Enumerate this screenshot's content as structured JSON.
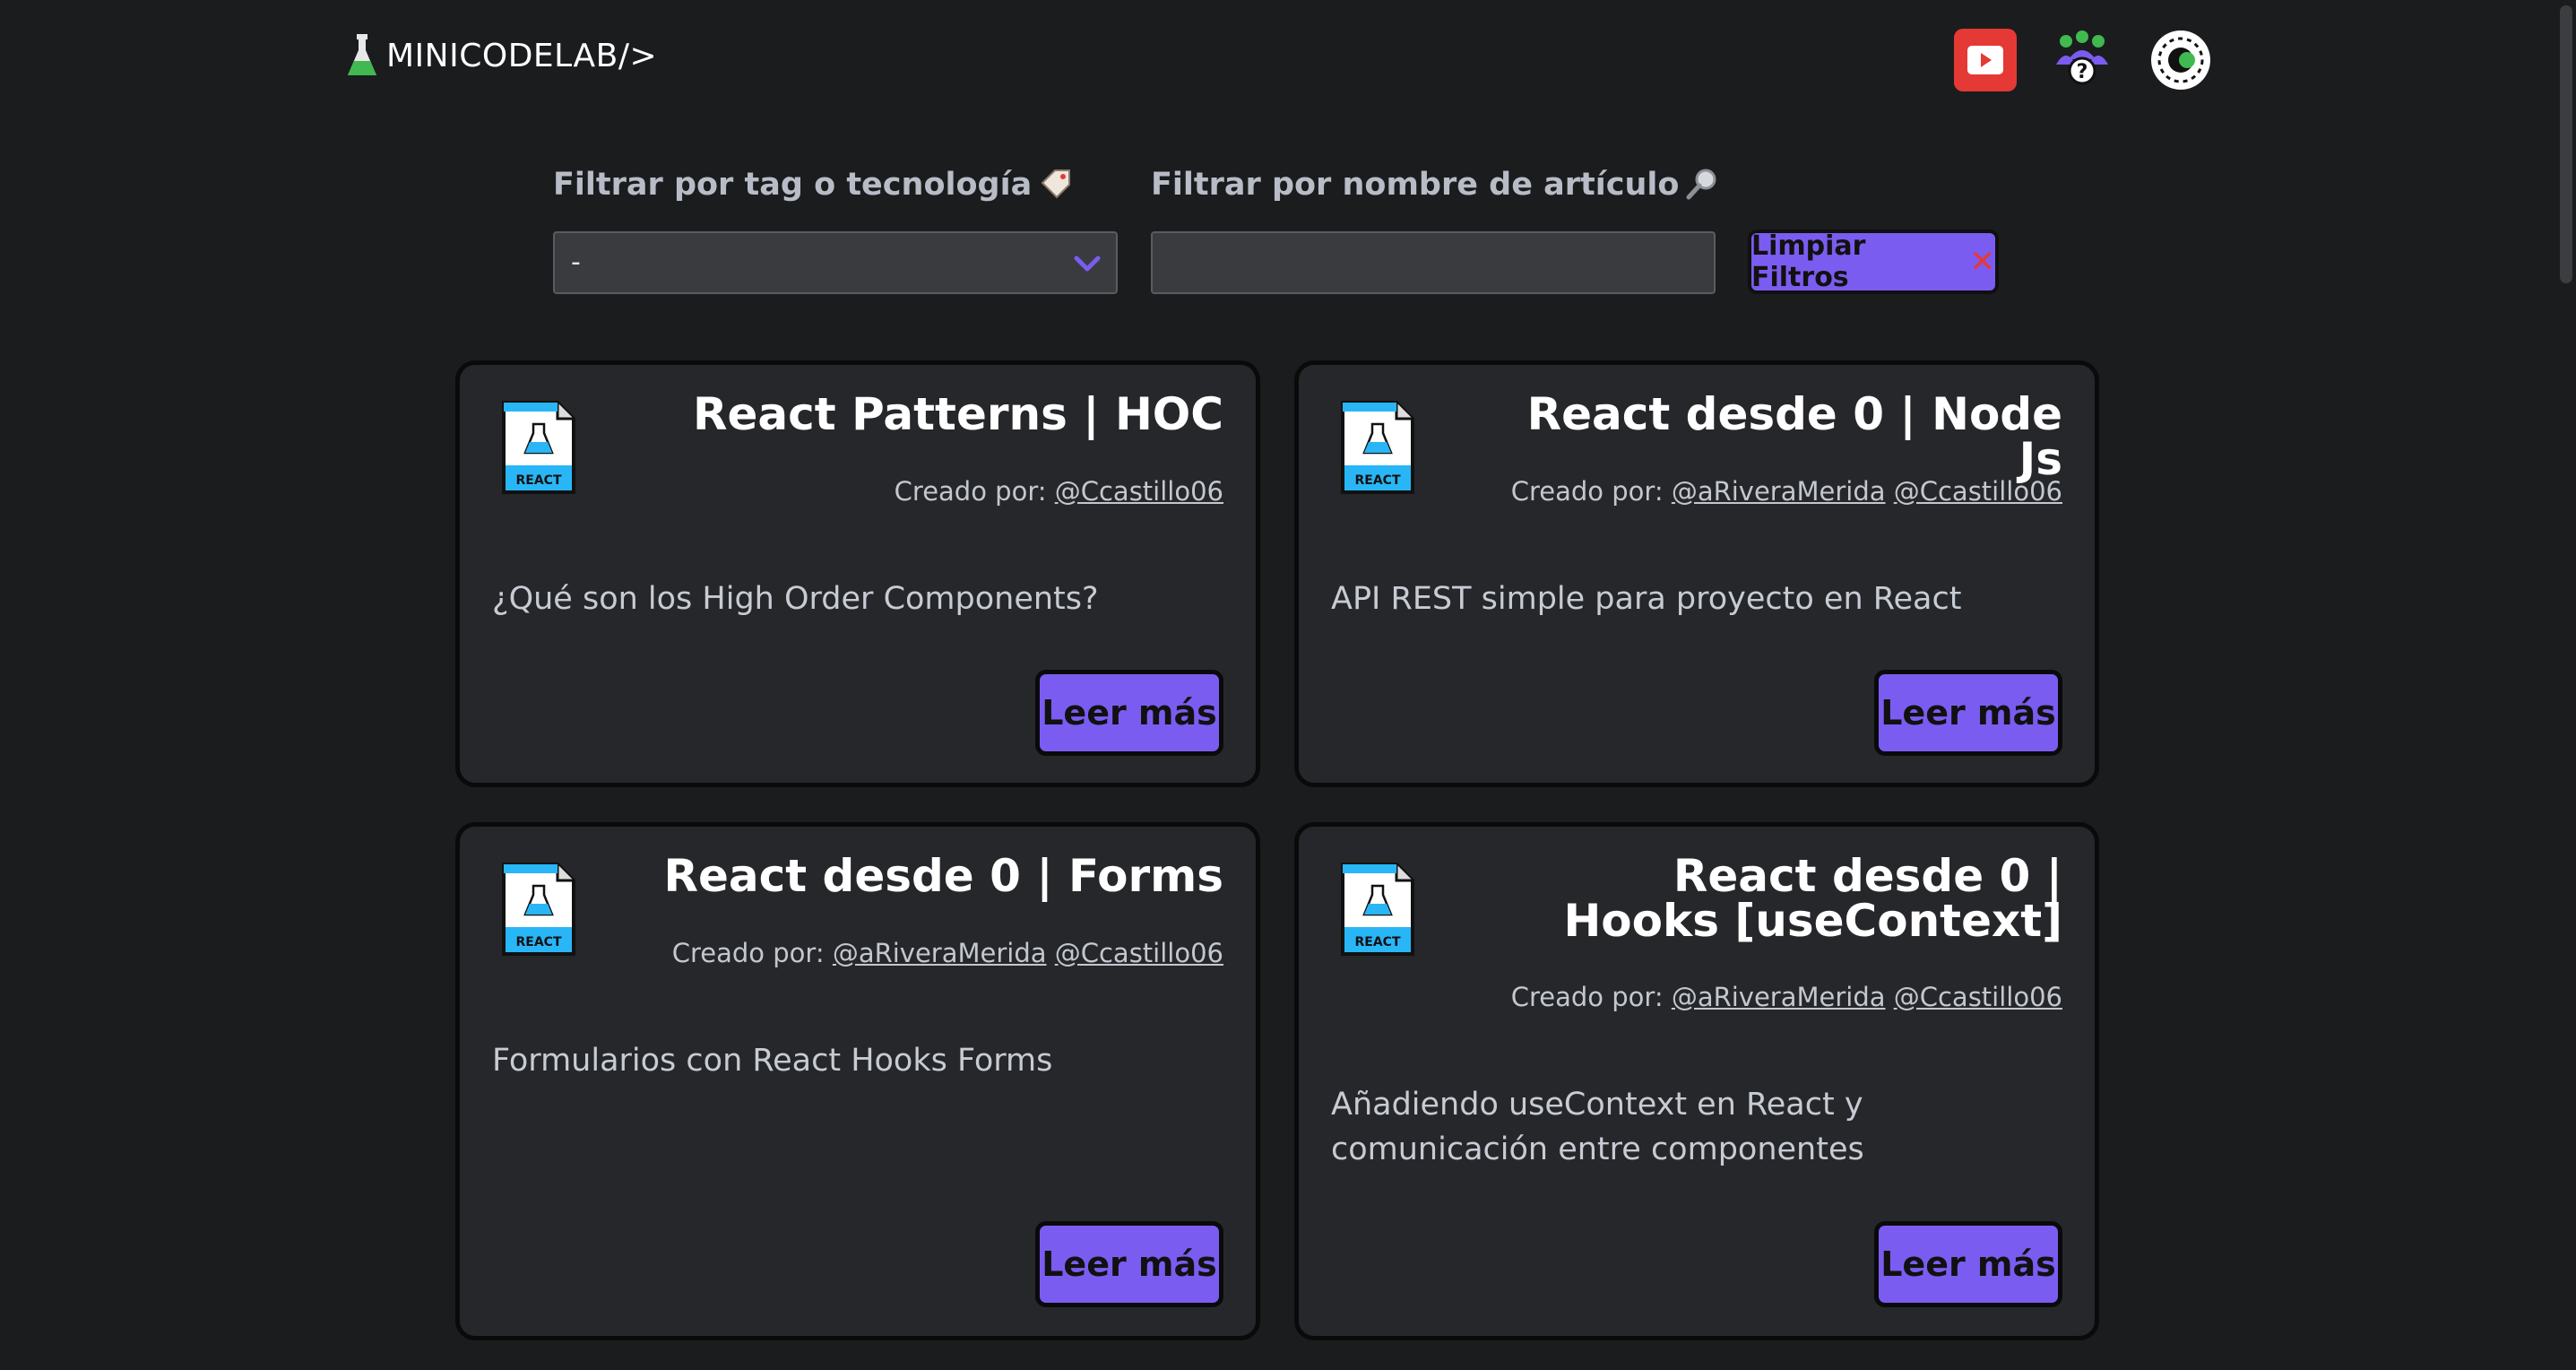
{
  "brand": {
    "name": "MINICODELAB/>"
  },
  "nav": {
    "youtube_icon": "youtube-icon",
    "community_icon": "community-help-icon",
    "theme_icon": "theme-toggle-icon"
  },
  "filters": {
    "tag_label": "Filtrar por tag o tecnología",
    "tag_selected": "-",
    "name_label": "Filtrar por nombre de artículo",
    "name_value": "",
    "clear_label": "Limpiar Filtros",
    "clear_icon": "✕"
  },
  "cards": [
    {
      "logo_label": "REACT",
      "title": "React Patterns | HOC",
      "author_prefix": "Creado por:",
      "authors": [
        "@Ccastillo06"
      ],
      "description": "¿Qué son los High Order Components?",
      "button": "Leer más"
    },
    {
      "logo_label": "REACT",
      "title": "React desde 0 | Node Js",
      "author_prefix": "Creado por:",
      "authors": [
        "@aRiveraMerida",
        "@Ccastillo06"
      ],
      "description": "API REST simple para proyecto en React",
      "button": "Leer más"
    },
    {
      "logo_label": "REACT",
      "title": "React desde 0 | Forms",
      "author_prefix": "Creado por:",
      "authors": [
        "@aRiveraMerida",
        "@Ccastillo06"
      ],
      "description": "Formularios con React Hooks Forms",
      "button": "Leer más"
    },
    {
      "logo_label": "REACT",
      "title": "React desde 0 | Hooks [useContext]",
      "author_prefix": "Creado por:",
      "authors": [
        "@aRiveraMerida",
        "@Ccastillo06"
      ],
      "description": "Añadiendo useContext en React y comunicación entre componentes",
      "button": "Leer más"
    }
  ],
  "colors": {
    "accent": "#7b5cf0",
    "background": "#1b1c1e",
    "card": "#26272a"
  }
}
